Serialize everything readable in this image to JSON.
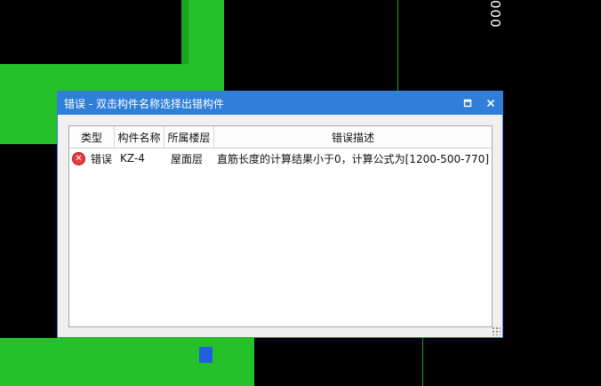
{
  "background_label": "000",
  "dialog": {
    "title": "错误 - 双击构件名称选择出错构件",
    "minimize_icon": "minimize-icon",
    "close_icon": "close-icon",
    "columns": [
      "类型",
      "构件名称",
      "所属楼层",
      "错误描述"
    ],
    "rows": [
      {
        "icon": "error-icon",
        "type": "错误",
        "name": "KZ-4",
        "floor": "屋面层",
        "description": "直筋长度的计算结果小于0，计算公式为[1200-500-770]"
      }
    ]
  },
  "colors": {
    "cad_green": "#25c12a",
    "cad_blue": "#1f5fe0",
    "title_bar": "#2f7fd8"
  }
}
